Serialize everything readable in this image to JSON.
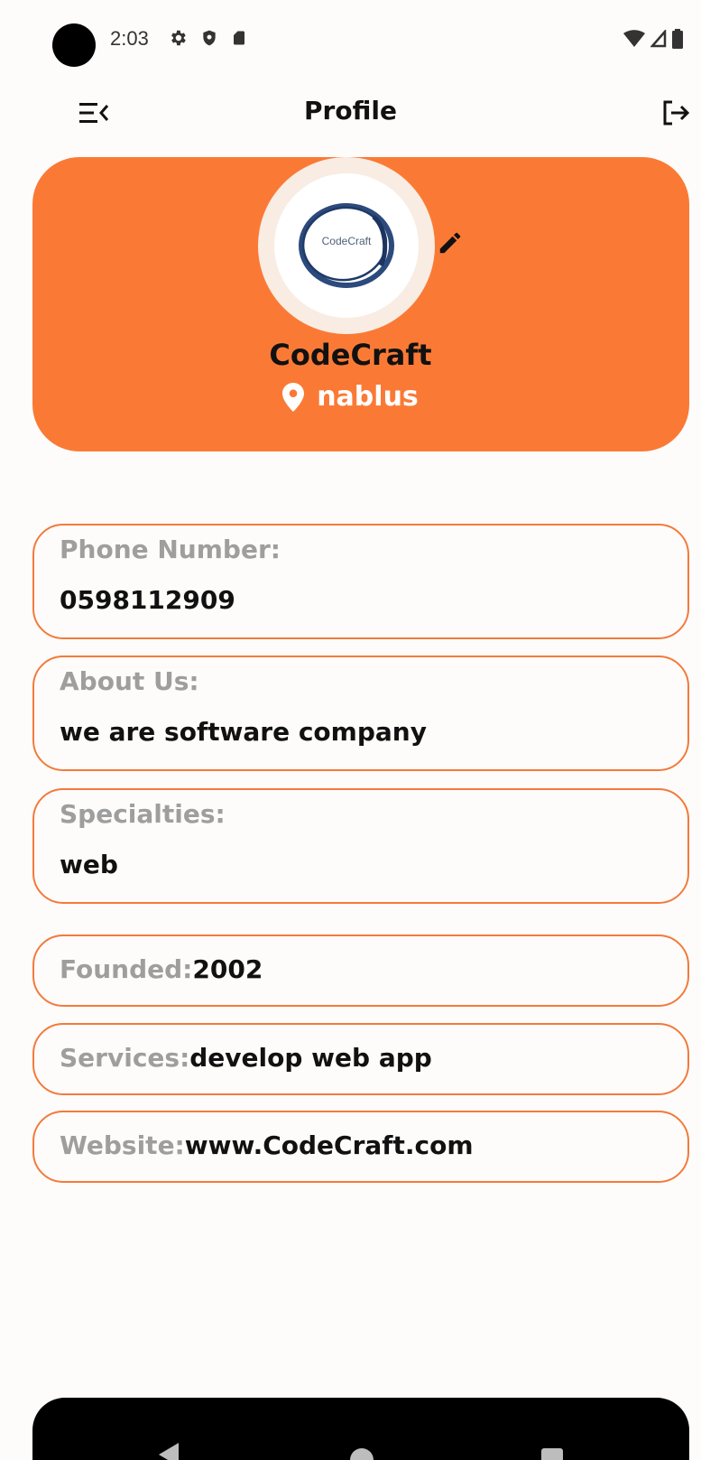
{
  "status_bar": {
    "time": "2:03",
    "icons": [
      "gear-icon",
      "shield-icon",
      "sd-card-icon"
    ],
    "right_icons": [
      "wifi-icon",
      "signal-icon",
      "battery-icon"
    ]
  },
  "app_bar": {
    "title": "Profile",
    "menu_icon": "menu-collapse-icon",
    "logout_icon": "logout-icon"
  },
  "profile": {
    "logo_text": "CodeCraft",
    "name": "CodeCraft",
    "location": "nablus",
    "location_icon": "location-pin-icon",
    "edit_icon": "pencil-icon"
  },
  "fields": {
    "phone": {
      "label": "Phone Number:",
      "value": "0598112909"
    },
    "about": {
      "label": "About Us:",
      "value": "we are software company"
    },
    "specialties": {
      "label": "Specialties:",
      "value": "web"
    },
    "founded": {
      "label": "Founded:",
      "value": "2002"
    },
    "services": {
      "label": "Services:",
      "value": "develop web app"
    },
    "website": {
      "label": "Website:",
      "value": "www.CodeCraft.com"
    }
  },
  "colors": {
    "accent": "#fa7a35",
    "border": "#f37a3b",
    "label": "#9e9e9e",
    "background": "#fefcfb"
  },
  "nav_bar": {
    "icons": [
      "back-triangle-icon",
      "home-circle-icon",
      "recents-square-icon"
    ]
  }
}
